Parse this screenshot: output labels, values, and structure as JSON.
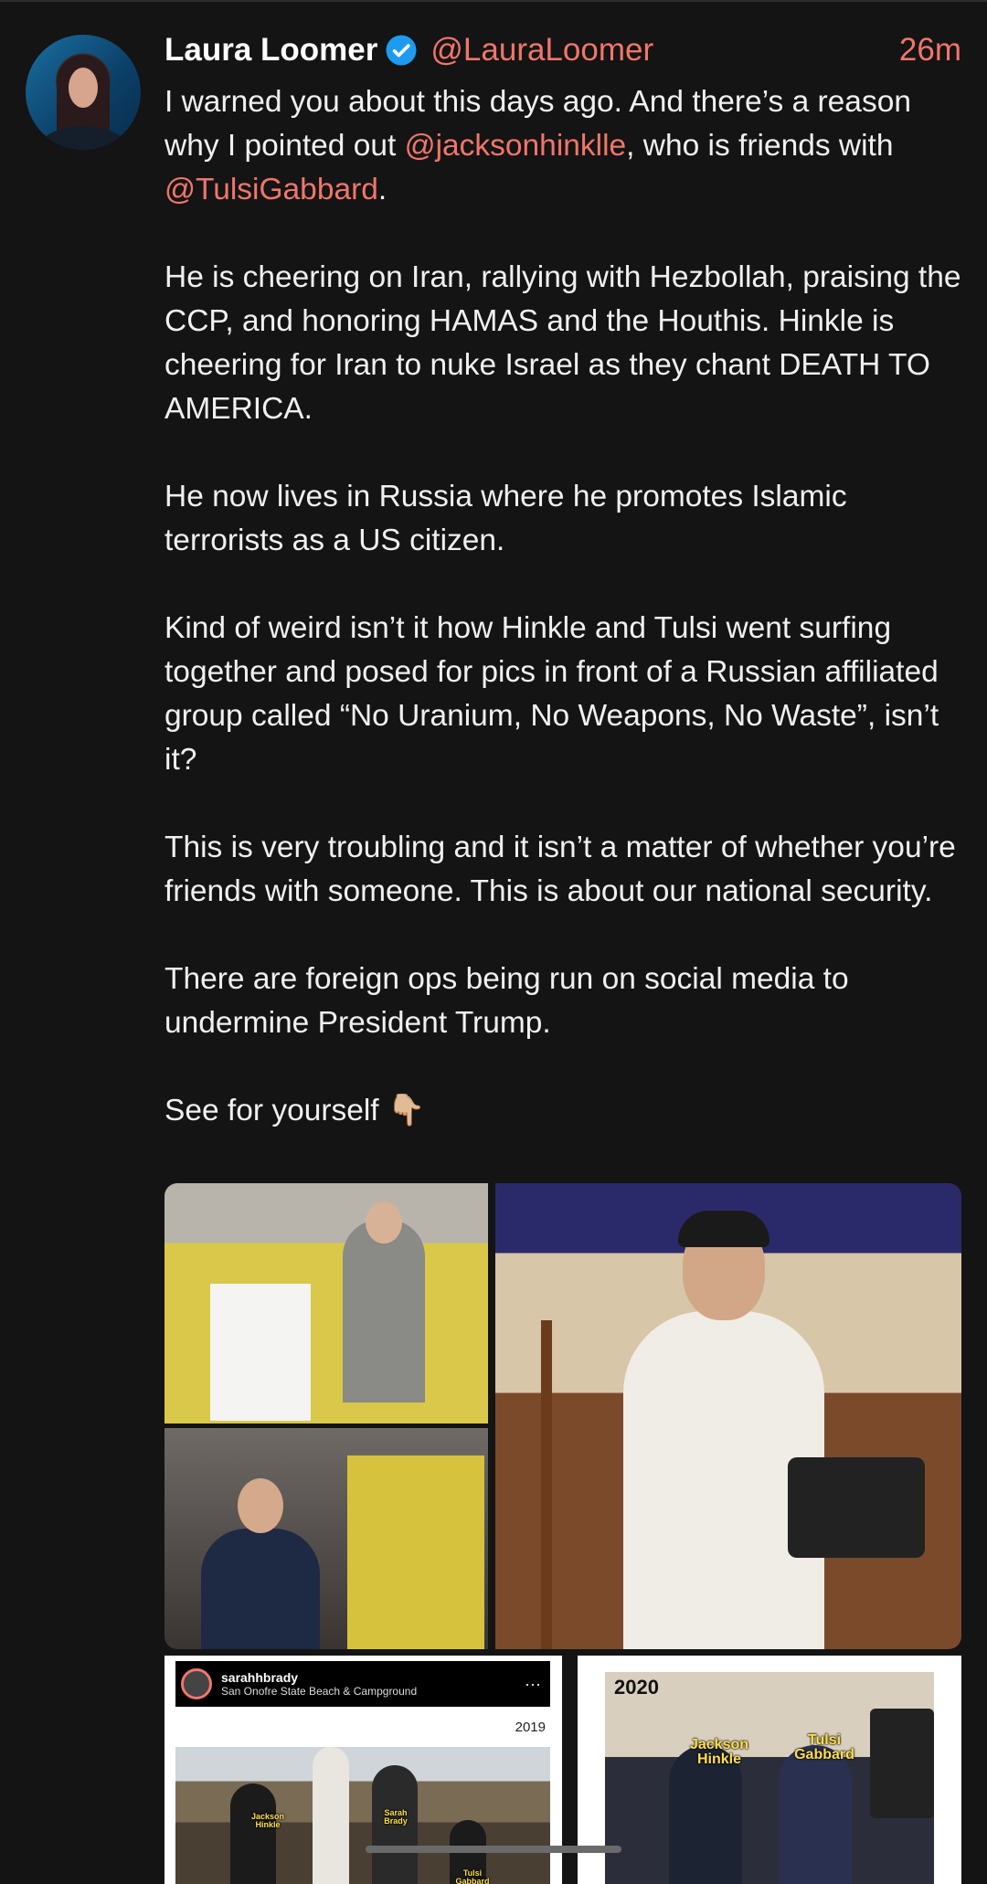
{
  "post": {
    "author_name": "Laura Loomer",
    "handle": "@LauraLoomer",
    "time": "26m",
    "line1_pre": "I warned you about this days ago. And there’s a reason why I pointed out ",
    "mention1": "@jacksonhinklle",
    "line1_mid": ", who is friends with ",
    "mention2": "@TulsiGabbard",
    "line1_post": ".",
    "para2": "He is cheering on Iran, rallying with Hezbollah, praising the CCP, and honoring HAMAS and the Houthis. Hinkle is cheering for Iran to nuke Israel as they chant DEATH TO AMERICA.",
    "para3": "He now lives in Russia where he promotes Islamic terrorists as a US citizen.",
    "para4": "Kind of weird isn’t it how Hinkle and Tulsi went surfing together and posed for pics in front of a Russian affiliated group called “No Uranium, No Weapons, No Waste”, isn’t it?",
    "para5": "This is very troubling and it isn’t a matter of whether you’re friends with someone. This is about our national security.",
    "para6": "There are foreign ops being run on social media to undermine President Trump.",
    "para7": "See for yourself 👇🏼"
  },
  "media": {
    "ig_user": "sarahhbrady",
    "ig_location": "San Onofre State Beach & Campground",
    "ig_more": "···",
    "year_a": "2019",
    "year_b": "2020",
    "tag_jackson": "Jackson Hinkle",
    "tag_sarah": "Sarah Brady",
    "tag_tulsi": "Tulsi Gabbard"
  },
  "colors": {
    "accent": "#f0766a",
    "verified": "#1d9bf0",
    "background": "#141414"
  }
}
